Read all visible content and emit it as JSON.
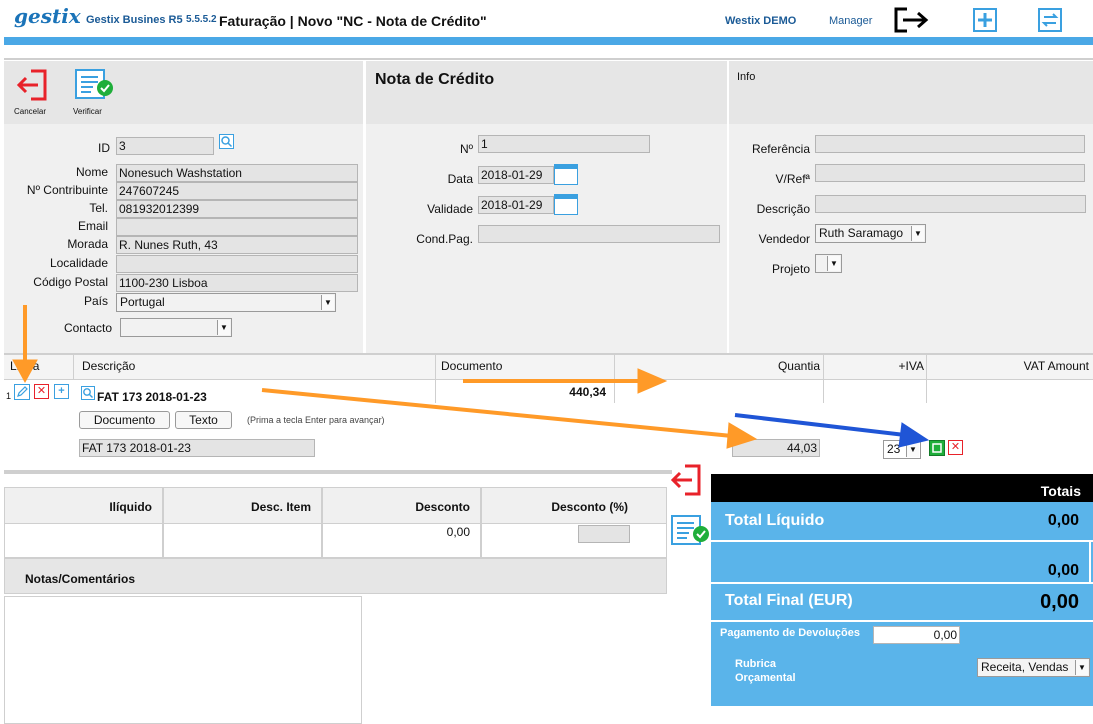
{
  "header": {
    "logo": "gestix",
    "app_name": "Gestix Busines R5",
    "version": "5.5.5.2",
    "page_title": "Faturação | Novo \"NC - Nota de Crédito\"",
    "company": "Westix DEMO",
    "user": "Manager"
  },
  "toolbar": {
    "cancel_label": "Cancelar",
    "verify_label": "Verificar"
  },
  "customer": {
    "labels": {
      "id": "ID",
      "name": "Nome",
      "taxid": "Nº Contribuinte",
      "phone": "Tel.",
      "email": "Email",
      "address": "Morada",
      "locality": "Localidade",
      "postal": "Código Postal",
      "country": "País",
      "contact": "Contacto"
    },
    "id": "3",
    "name": "Nonesuch Washstation",
    "taxid": "247607245",
    "phone": "081932012399",
    "email": "",
    "address": "R. Nunes Ruth, 43",
    "locality": "",
    "postal": "1100-230 Lisboa",
    "country": "Portugal",
    "contact": ""
  },
  "document": {
    "title": "Nota de Crédito",
    "labels": {
      "number": "Nº",
      "date": "Data",
      "validity": "Validade",
      "payment": "Cond.Pag."
    },
    "number": "1",
    "date": "2018-01-29",
    "validity": "2018-01-29",
    "payment": ""
  },
  "info": {
    "title": "Info",
    "labels": {
      "reference": "Referência",
      "yourref": "V/Refª",
      "description": "Descrição",
      "seller": "Vendedor",
      "project": "Projeto"
    },
    "reference": "",
    "yourref": "",
    "description": "",
    "seller": "Ruth Saramago",
    "project": ""
  },
  "lines": {
    "columns": {
      "line": "Linha",
      "description": "Descrição",
      "document": "Documento",
      "quantity": "Quantia",
      "vat": "+IVA",
      "vat_amount": "VAT Amount"
    },
    "row": {
      "index": "1",
      "description": "FAT 173 2018-01-23",
      "document_amount": "440,34",
      "btn_document": "Documento",
      "btn_text": "Texto",
      "hint": "(Prima a tecla Enter para avançar)",
      "desc_input": "FAT 173 2018-01-23",
      "quantity": "44,03",
      "vat_rate": "23"
    }
  },
  "summary": {
    "columns": {
      "net": "Ilíquido",
      "item_discount": "Desc. Item",
      "discount": "Desconto",
      "discount_pct": "Desconto (%)"
    },
    "discount_value": "0,00",
    "notes_label": "Notas/Comentários"
  },
  "totals": {
    "header": "Totais",
    "net_label": "Total Líquido",
    "net_value": "0,00",
    "tax_value": "0,00",
    "final_label": "Total Final (EUR)",
    "final_value": "0,00",
    "refund_label": "Pagamento de Devoluções",
    "refund_value": "0,00",
    "budget_label_1": "Rubrica",
    "budget_label_2": "Orçamental",
    "budget_value": "Receita, Vendas"
  },
  "colors": {
    "accent": "#4aa8e6",
    "totals_bg": "#5ab4ea",
    "arrow_orange": "#ff9a28",
    "arrow_blue": "#1f55d6",
    "cancel_red": "#e8222a",
    "verify_green": "#1fae3a"
  },
  "icons": [
    "logout-icon",
    "add-icon",
    "refresh-icon",
    "cancel-icon",
    "verify-icon",
    "search-icon",
    "calendar-icon",
    "edit-icon",
    "delete-icon",
    "add-line-icon",
    "confirm-icon"
  ]
}
